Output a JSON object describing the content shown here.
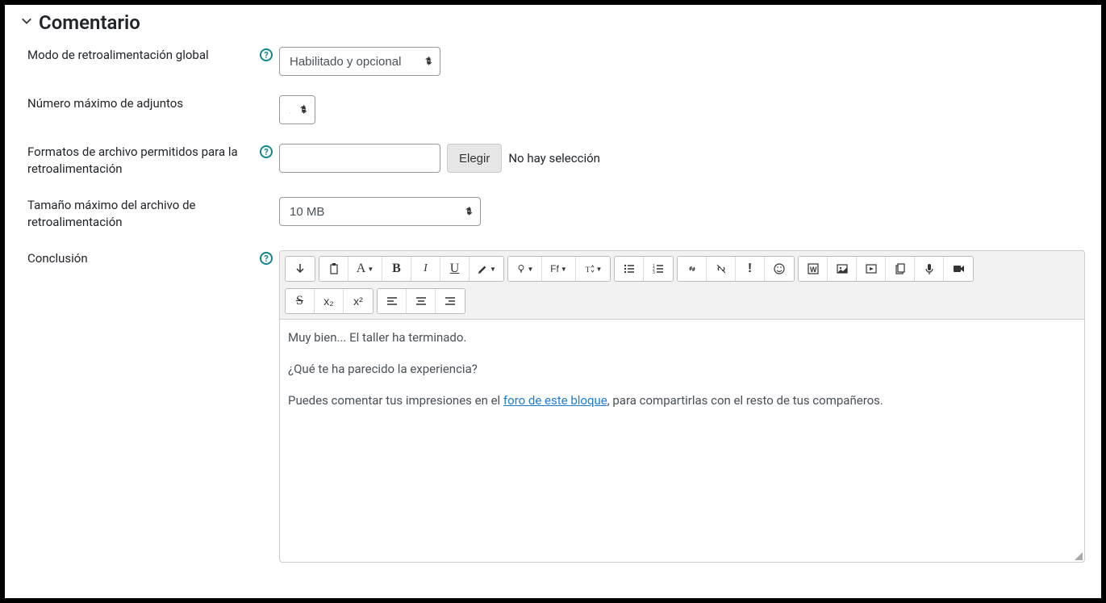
{
  "section": {
    "title": "Comentario"
  },
  "fields": {
    "overallFeedbackMode": {
      "label": "Modo de retroalimentación global",
      "selected": "Habilitado y opcional"
    },
    "maxAttachments": {
      "label": "Número máximo de adjuntos",
      "selected": "2"
    },
    "allowedFormats": {
      "label": "Formatos de archivo permitidos para la retroalimentación",
      "value": "",
      "chooseLabel": "Elegir",
      "noSelection": "No hay selección"
    },
    "maxFileSize": {
      "label": "Tamaño máximo del archivo de retroalimentación",
      "selected": "10 MB"
    },
    "conclusion": {
      "label": "Conclusión",
      "content": {
        "p1": "Muy bien... El taller ha terminado.",
        "p2": "¿Qué te ha parecido la experiencia?",
        "p3_before": "Puedes comentar tus impresiones en el ",
        "p3_link": "foro de este bloque",
        "p3_after": ", para compartirlas con el resto de tus compañeros."
      }
    }
  },
  "toolbar": {
    "arrowDown": "⤓",
    "fontLabel": "Ff",
    "sizeLabel": "T↑",
    "subscript": "x₂",
    "superscript": "x²"
  }
}
